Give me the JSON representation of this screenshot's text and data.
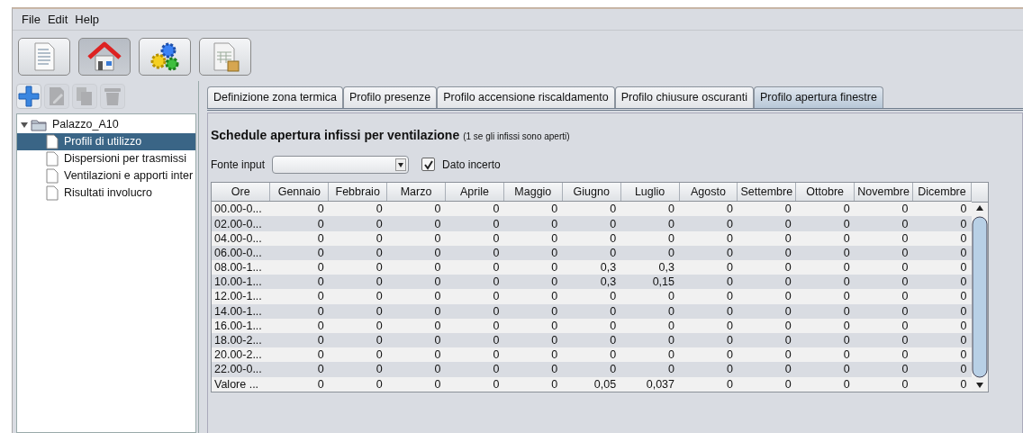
{
  "menu": [
    "File",
    "Edit",
    "Help"
  ],
  "toolbar": [
    {
      "kind": "document",
      "selected": false
    },
    {
      "kind": "house",
      "selected": true
    },
    {
      "kind": "gears",
      "selected": false
    },
    {
      "kind": "report",
      "selected": false
    }
  ],
  "tree_toolbar": [
    {
      "kind": "add",
      "disabled": false
    },
    {
      "kind": "edit",
      "disabled": true
    },
    {
      "kind": "copy",
      "disabled": true
    },
    {
      "kind": "delete",
      "disabled": true
    }
  ],
  "tree": [
    {
      "label": "Palazzo_A10",
      "expanded": true,
      "selected": false,
      "children": [
        {
          "label": "Profili di utilizzo",
          "selected": true
        },
        {
          "label": "Dispersioni per trasmissi",
          "selected": false
        },
        {
          "label": "Ventilazioni e apporti inter",
          "selected": false
        },
        {
          "label": "Risultati involucro",
          "selected": false
        }
      ]
    }
  ],
  "tabs": [
    {
      "label": "Definizione zona termica",
      "selected": false
    },
    {
      "label": "Profilo presenze",
      "selected": false
    },
    {
      "label": "Profilo accensione riscaldamento",
      "selected": false
    },
    {
      "label": "Profilo chiusure oscuranti",
      "selected": false
    },
    {
      "label": "Profilo apertura finestre",
      "selected": true
    }
  ],
  "panel": {
    "title": "Schedule apertura infissi per ventilazione",
    "note": "(1 se gli infissi sono aperti)",
    "source_label": "Fonte input",
    "uncertain": {
      "label": "Dato incerto",
      "checked": true
    }
  },
  "table": {
    "columns": [
      "Ore",
      "Gennaio",
      "Febbraio",
      "Marzo",
      "Aprile",
      "Maggio",
      "Giugno",
      "Luglio",
      "Agosto",
      "Settembre",
      "Ottobre",
      "Novembre",
      "Dicembre"
    ],
    "rows": [
      [
        "00.00-0...",
        "0",
        "0",
        "0",
        "0",
        "0",
        "0",
        "0",
        "0",
        "0",
        "0",
        "0",
        "0"
      ],
      [
        "02.00-0...",
        "0",
        "0",
        "0",
        "0",
        "0",
        "0",
        "0",
        "0",
        "0",
        "0",
        "0",
        "0"
      ],
      [
        "04.00-0...",
        "0",
        "0",
        "0",
        "0",
        "0",
        "0",
        "0",
        "0",
        "0",
        "0",
        "0",
        "0"
      ],
      [
        "06.00-0...",
        "0",
        "0",
        "0",
        "0",
        "0",
        "0",
        "0",
        "0",
        "0",
        "0",
        "0",
        "0"
      ],
      [
        "08.00-1...",
        "0",
        "0",
        "0",
        "0",
        "0",
        "0,3",
        "0,3",
        "0",
        "0",
        "0",
        "0",
        "0"
      ],
      [
        "10.00-1...",
        "0",
        "0",
        "0",
        "0",
        "0",
        "0,3",
        "0,15",
        "0",
        "0",
        "0",
        "0",
        "0"
      ],
      [
        "12.00-1...",
        "0",
        "0",
        "0",
        "0",
        "0",
        "0",
        "0",
        "0",
        "0",
        "0",
        "0",
        "0"
      ],
      [
        "14.00-1...",
        "0",
        "0",
        "0",
        "0",
        "0",
        "0",
        "0",
        "0",
        "0",
        "0",
        "0",
        "0"
      ],
      [
        "16.00-1...",
        "0",
        "0",
        "0",
        "0",
        "0",
        "0",
        "0",
        "0",
        "0",
        "0",
        "0",
        "0"
      ],
      [
        "18.00-2...",
        "0",
        "0",
        "0",
        "0",
        "0",
        "0",
        "0",
        "0",
        "0",
        "0",
        "0",
        "0"
      ],
      [
        "20.00-2...",
        "0",
        "0",
        "0",
        "0",
        "0",
        "0",
        "0",
        "0",
        "0",
        "0",
        "0",
        "0"
      ],
      [
        "22.00-0...",
        "0",
        "0",
        "0",
        "0",
        "0",
        "0",
        "0",
        "0",
        "0",
        "0",
        "0",
        "0"
      ],
      [
        "Valore ...",
        "0",
        "0",
        "0",
        "0",
        "0",
        "0,05",
        "0,037",
        "0",
        "0",
        "0",
        "0",
        "0"
      ]
    ]
  }
}
